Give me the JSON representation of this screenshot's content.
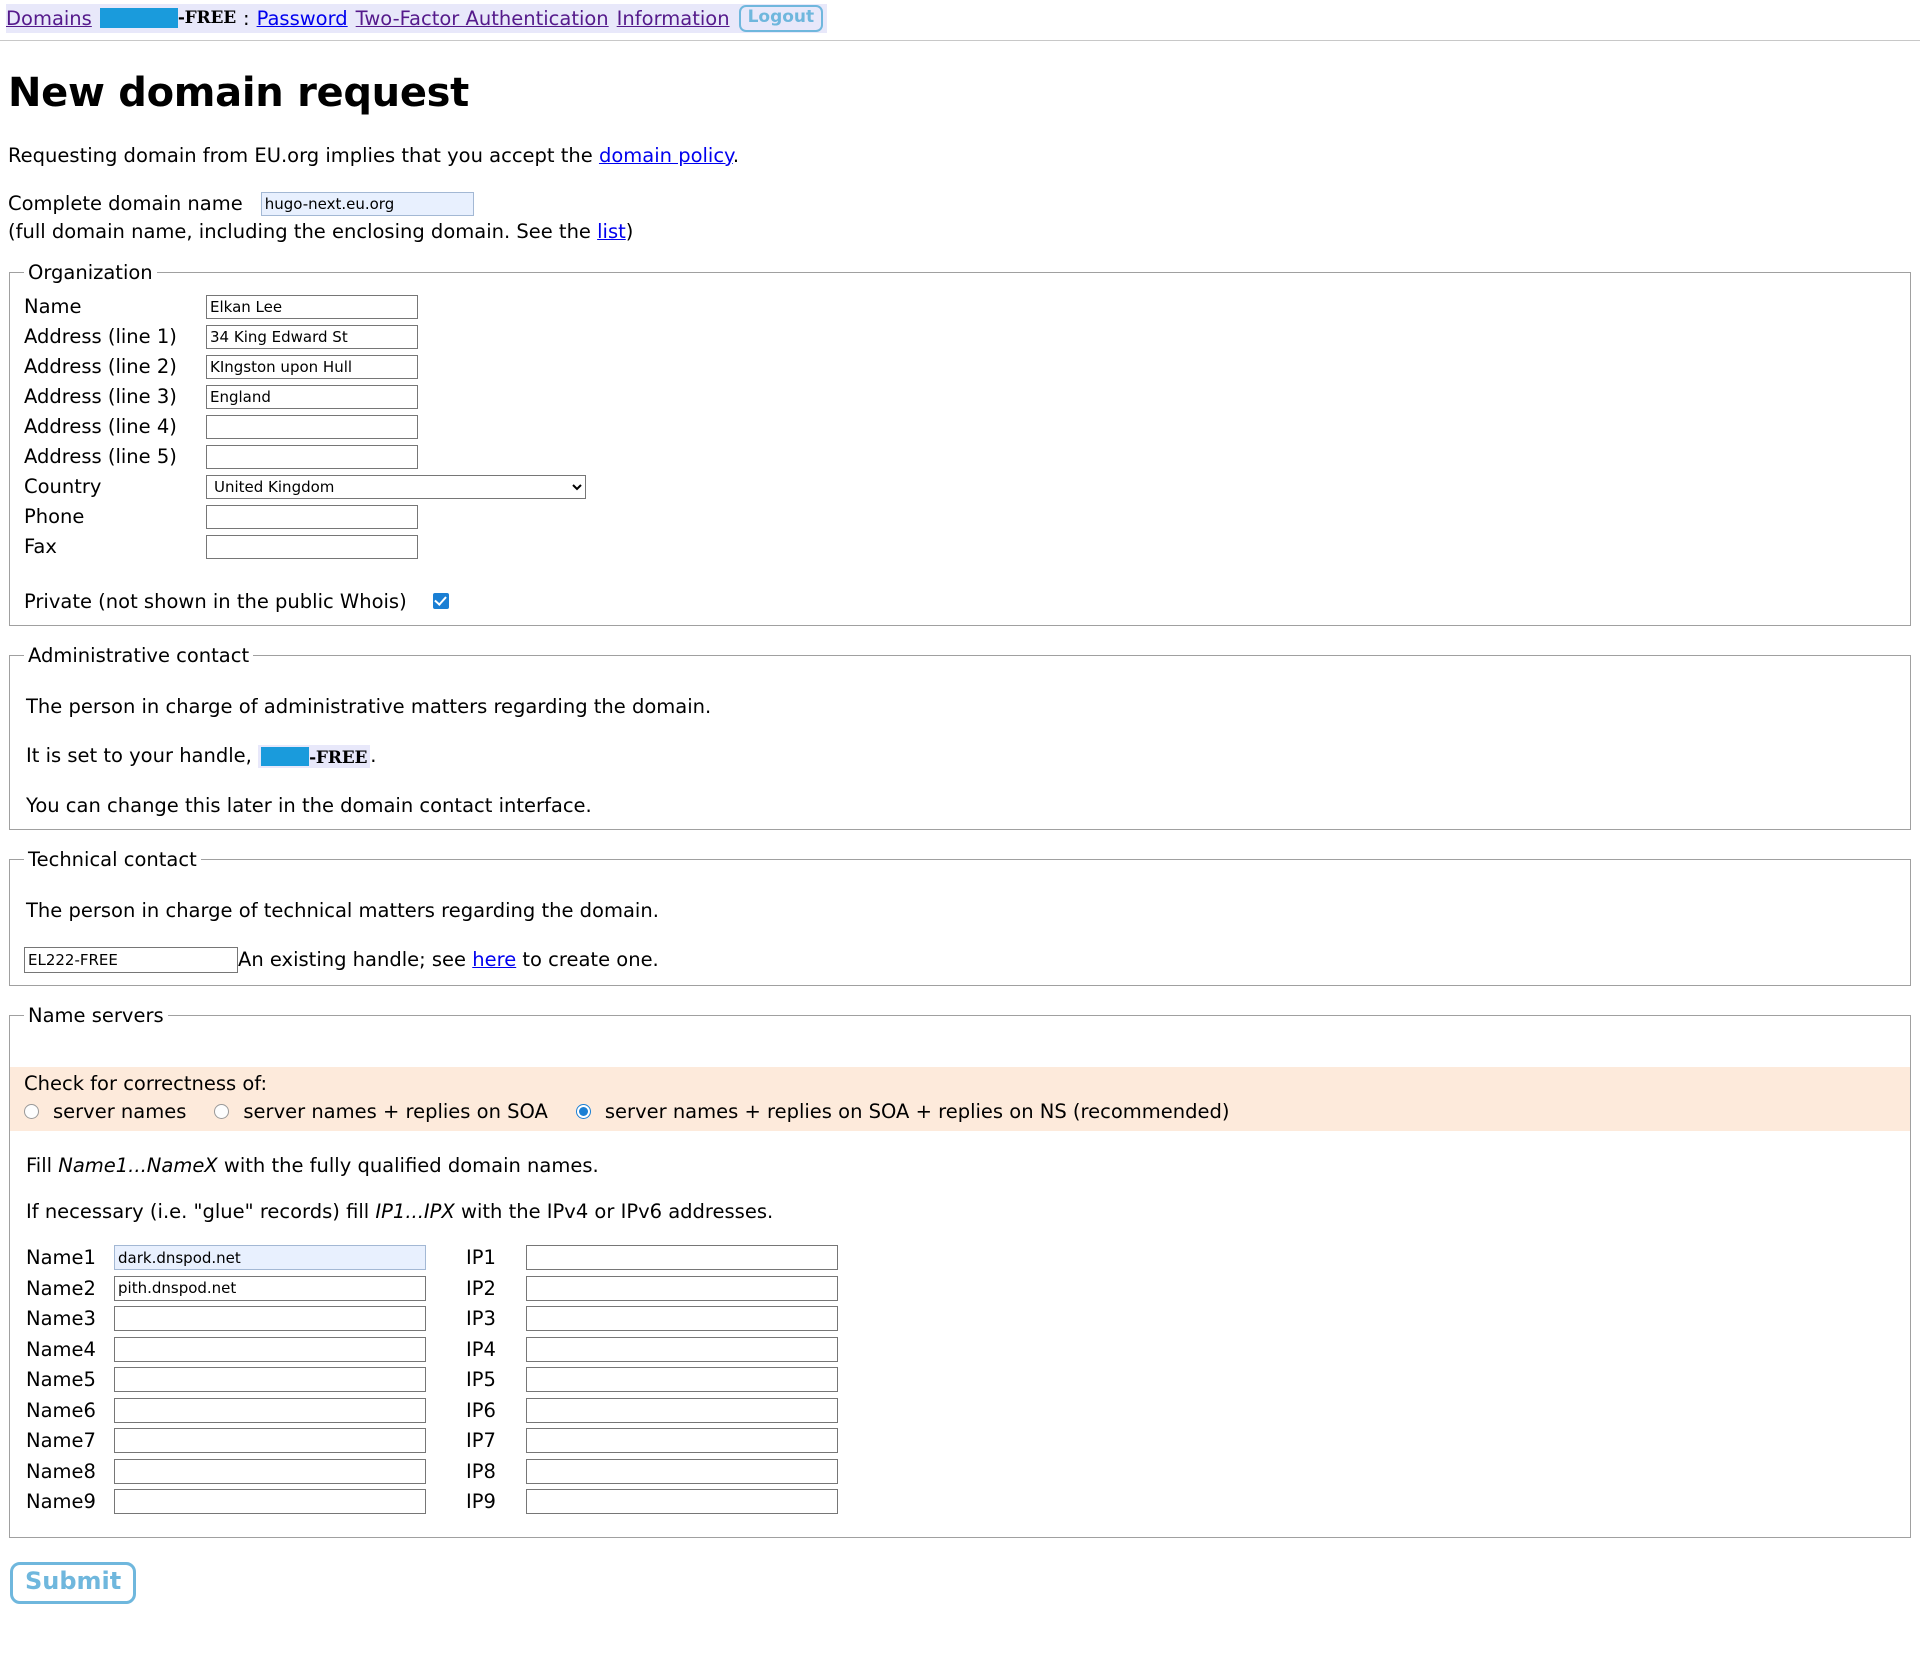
{
  "nav": {
    "domains_label": "Domains",
    "handle_redacted": "",
    "handle_suffix": "-FREE",
    "separator": ":",
    "password_label": "Password",
    "two_factor_label": "Two-Factor Authentication",
    "information_label": "Information",
    "logout_label": "Logout"
  },
  "page": {
    "title": "New domain request",
    "intro_before": "Requesting domain from EU.org implies that you accept the ",
    "intro_link": "domain policy",
    "intro_after": ".",
    "domain_label": "Complete domain name",
    "domain_value": "hugo-next.eu.org",
    "domain_note_before": "(full domain name, including the enclosing domain. See the ",
    "domain_note_link": "list",
    "domain_note_after": ")"
  },
  "organization": {
    "legend": "Organization",
    "fields": [
      {
        "label": "Name",
        "value": "Elkan Lee"
      },
      {
        "label": "Address (line 1)",
        "value": "34 King Edward St"
      },
      {
        "label": "Address (line 2)",
        "value": "KIngston upon Hull"
      },
      {
        "label": "Address (line 3)",
        "value": "England"
      },
      {
        "label": "Address (line 4)",
        "value": ""
      },
      {
        "label": "Address (line 5)",
        "value": ""
      }
    ],
    "country_label": "Country",
    "country_value": "United Kingdom",
    "phone_label": "Phone",
    "phone_value": "",
    "fax_label": "Fax",
    "fax_value": "",
    "private_label": "Private (not shown in the public Whois)",
    "private_checked": true
  },
  "admin_contact": {
    "legend": "Administrative contact",
    "line1": "The person in charge of administrative matters regarding the domain.",
    "line2_before": "It is set to your handle, ",
    "line2_handle_suffix": "-FREE",
    "line2_after": ".",
    "line3": "You can change this later in the domain contact interface."
  },
  "technical_contact": {
    "legend": "Technical contact",
    "line1": "The person in charge of technical matters regarding the domain.",
    "handle_value": "EL222-FREE",
    "after_before": "An existing handle; see ",
    "after_link": "here",
    "after_after": " to create one."
  },
  "name_servers": {
    "legend": "Name servers",
    "check_title": "Check for correctness of:",
    "options": [
      {
        "label": "server names",
        "selected": false
      },
      {
        "label": "server names + replies on SOA",
        "selected": false
      },
      {
        "label": "server names + replies on SOA + replies on NS (recommended)",
        "selected": true
      }
    ],
    "note1_parts": [
      "Fill ",
      "Name1...NameX",
      " with the fully qualified domain names."
    ],
    "note2_parts": [
      "If necessary (i.e. \"glue\" records) fill ",
      "IP1...IPX",
      " with the IPv4 or IPv6 addresses."
    ],
    "rows": [
      {
        "name_label": "Name1",
        "name_value": "dark.dnspod.net",
        "name_autofill": true,
        "ip_label": "IP1",
        "ip_value": ""
      },
      {
        "name_label": "Name2",
        "name_value": "pith.dnspod.net",
        "name_autofill": false,
        "ip_label": "IP2",
        "ip_value": ""
      },
      {
        "name_label": "Name3",
        "name_value": "",
        "name_autofill": false,
        "ip_label": "IP3",
        "ip_value": ""
      },
      {
        "name_label": "Name4",
        "name_value": "",
        "name_autofill": false,
        "ip_label": "IP4",
        "ip_value": ""
      },
      {
        "name_label": "Name5",
        "name_value": "",
        "name_autofill": false,
        "ip_label": "IP5",
        "ip_value": ""
      },
      {
        "name_label": "Name6",
        "name_value": "",
        "name_autofill": false,
        "ip_label": "IP6",
        "ip_value": ""
      },
      {
        "name_label": "Name7",
        "name_value": "",
        "name_autofill": false,
        "ip_label": "IP7",
        "ip_value": ""
      },
      {
        "name_label": "Name8",
        "name_value": "",
        "name_autofill": false,
        "ip_label": "IP8",
        "ip_value": ""
      },
      {
        "name_label": "Name9",
        "name_value": "",
        "name_autofill": false,
        "ip_label": "IP9",
        "ip_value": ""
      }
    ]
  },
  "submit": {
    "label": "Submit"
  },
  "colors": {
    "nav_background": "#e8e8fa",
    "redaction": "#1a9bdc",
    "link_purple": "#551a8b",
    "link_blue": "#0000ee",
    "accent_button": "#6fb7dd",
    "autofill_background": "#e8f0fe",
    "band_background": "#fdeadb",
    "control_accent": "#1a7fd4"
  }
}
